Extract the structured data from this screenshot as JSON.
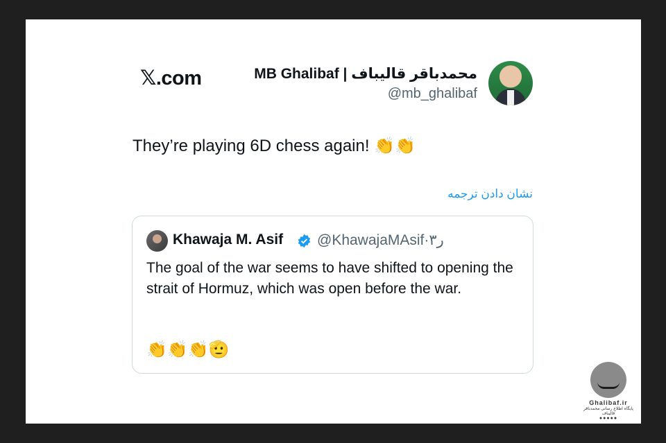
{
  "post": {
    "site": ".com",
    "site_x": "𝕏",
    "author_name": "MB Ghalibaf | محمدباقر قالیباف",
    "author_handle": "@mb_ghalibaf",
    "text": "They’re playing 6D chess again!",
    "text_emojis": "👏👏",
    "translate_link": "نشان دادن ترجمه"
  },
  "quoted": {
    "name": "Khawaja M. Asif",
    "handle": "@KhawajaMAsif·۳ر",
    "text": "The goal of the war seems to have shifted to opening the strait of Hormuz, which was open before the war.",
    "emojis": "👏👏👏🫡"
  },
  "watermark": {
    "site": "Ghalibaf.ir",
    "subtitle": "پایگاه اطلاع رسانی محمدباقر قالیباف",
    "icons": "●●●●●"
  },
  "colors": {
    "accent": "#1d9bf0",
    "verified": "#1d9bf0",
    "frame": "#1f1f1f"
  }
}
